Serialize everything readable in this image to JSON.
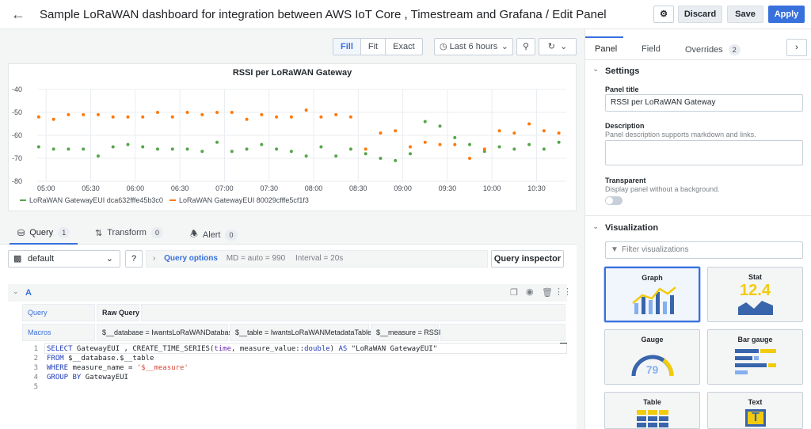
{
  "header": {
    "title": "Sample LoRaWAN dashboard for integration between AWS IoT Core , Timestream and Grafana / Edit Panel",
    "discard_label": "Discard",
    "save_label": "Save",
    "apply_label": "Apply"
  },
  "toolbar": {
    "fill_label": "Fill",
    "fit_label": "Fit",
    "exact_label": "Exact",
    "time_range": "Last 6 hours"
  },
  "colors": {
    "series_green": "#56a64b",
    "series_orange": "#ff780a",
    "primary": "#3871dc"
  },
  "chart_data": {
    "type": "scatter",
    "title": "RSSI per LoRaWAN Gateway",
    "x_ticks": [
      "05:00",
      "05:30",
      "06:00",
      "06:30",
      "07:00",
      "07:30",
      "08:00",
      "08:30",
      "09:00",
      "09:30",
      "10:00",
      "10:30"
    ],
    "y_ticks": [
      "-40",
      "-50",
      "-60",
      "-70",
      "-80"
    ],
    "ylim": [
      -80,
      -40
    ],
    "x_range": [
      "04:54",
      "10:50"
    ],
    "legend_position": "bottom-left",
    "grid": true,
    "series": [
      {
        "name": "LoRaWAN GatewayEUI dca632fffe45b3c0",
        "color": "#56a64b",
        "x": [
          "04:55",
          "05:05",
          "05:15",
          "05:25",
          "05:35",
          "05:45",
          "05:55",
          "06:05",
          "06:15",
          "06:25",
          "06:35",
          "06:45",
          "06:55",
          "07:05",
          "07:15",
          "07:25",
          "07:35",
          "07:45",
          "07:55",
          "08:05",
          "08:15",
          "08:25",
          "08:35",
          "08:45",
          "08:55",
          "09:05",
          "09:15",
          "09:25",
          "09:35",
          "09:45",
          "09:55",
          "10:05",
          "10:15",
          "10:25",
          "10:35",
          "10:45"
        ],
        "values": [
          -65,
          -66,
          -66,
          -66,
          -69,
          -65,
          -64,
          -65,
          -66,
          -66,
          -66,
          -67,
          -63,
          -67,
          -66,
          -64,
          -66,
          -67,
          -69,
          -65,
          -69,
          -66,
          -68,
          -70,
          -71,
          -68,
          -54,
          -56,
          -61,
          -64,
          -67,
          -65,
          -66,
          -64,
          -66,
          -63
        ]
      },
      {
        "name": "LoRaWAN GatewayEUI 80029cfffe5cf1f3",
        "color": "#ff780a",
        "x": [
          "04:55",
          "05:05",
          "05:15",
          "05:25",
          "05:35",
          "05:45",
          "05:55",
          "06:05",
          "06:15",
          "06:25",
          "06:35",
          "06:45",
          "06:55",
          "07:05",
          "07:15",
          "07:25",
          "07:35",
          "07:45",
          "07:55",
          "08:05",
          "08:15",
          "08:25",
          "08:35",
          "08:45",
          "08:55",
          "09:05",
          "09:15",
          "09:25",
          "09:35",
          "09:45",
          "09:55",
          "10:05",
          "10:15",
          "10:25",
          "10:35",
          "10:45"
        ],
        "values": [
          -52,
          -53,
          -51,
          -51,
          -51,
          -52,
          -52,
          -52,
          -50,
          -52,
          -50,
          -51,
          -50,
          -50,
          -53,
          -51,
          -52,
          -52,
          -49,
          -52,
          -51,
          -52,
          -66,
          -59,
          -58,
          -65,
          -63,
          -64,
          -64,
          -70,
          -66,
          -58,
          -59,
          -55,
          -58,
          -59
        ]
      }
    ]
  },
  "query_tabs": [
    {
      "label": "Query",
      "count": "1"
    },
    {
      "label": "Transform",
      "count": "0"
    },
    {
      "label": "Alert",
      "count": "0"
    }
  ],
  "query": {
    "datasource": "default",
    "options_label": "Query options",
    "md_info": "MD = auto = 990",
    "interval_info": "Interval = 20s",
    "inspector_label": "Query inspector",
    "ref_id": "A",
    "mode_label": "Query",
    "raw_query_label": "Raw Query",
    "macros_label": "Macros",
    "macro_database": "$__database = IwantsLoRaWANDatabase",
    "macro_table": "$__table = IwantsLoRaWANMetadataTable",
    "macro_measure": "$__measure = RSSI",
    "line_numbers": [
      "1",
      "2",
      "3",
      "4",
      "5"
    ],
    "code": {
      "l1_select": "SELECT",
      "l1_a": " GatewayEUI , CREATE_TIME_SERIES(",
      "l1_time": "time",
      "l1_b": ", measure_value::",
      "l1_double": "double",
      "l1_c": ") ",
      "l1_as": "AS",
      "l1_d": " \"LoRaWAN GatewayEUI\"",
      "l2_from": "FROM",
      "l2_rest": " $__database.$__table",
      "l3_where": "WHERE",
      "l3_rest": " measure_name = ",
      "l3_str": "'$__measure'",
      "l4_group": "GROUP BY",
      "l4_rest": " GatewayEUI"
    }
  },
  "right_panel": {
    "tabs": {
      "panel": "Panel",
      "field": "Field",
      "overrides": "Overrides",
      "overrides_count": "2"
    },
    "settings_header": "Settings",
    "panel_title_label": "Panel title",
    "panel_title_value": "RSSI per LoRaWAN Gateway",
    "description_label": "Description",
    "description_help": "Panel description supports markdown and links.",
    "transparent_label": "Transparent",
    "transparent_help": "Display panel without a background.",
    "visualization_header": "Visualization",
    "filter_placeholder": "Filter visualizations",
    "viz": {
      "graph": "Graph",
      "stat": "Stat",
      "stat_value": "12.4",
      "gauge": "Gauge",
      "gauge_value": "79",
      "bar_gauge": "Bar gauge",
      "table": "Table",
      "text": "Text",
      "text_glyph": "T"
    }
  }
}
